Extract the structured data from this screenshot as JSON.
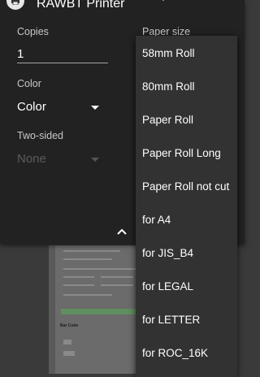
{
  "header": {
    "printer_name": "RAWBT Printer"
  },
  "copies": {
    "label": "Copies",
    "value": "1"
  },
  "color": {
    "label": "Color",
    "value": "Color"
  },
  "two_sided": {
    "label": "Two-sided",
    "value": "None"
  },
  "paper_size": {
    "label": "Paper size",
    "options": [
      "58mm Roll",
      "80mm Roll",
      "Paper Roll",
      "Paper Roll Long",
      "Paper Roll not cut",
      "for A4",
      "for JIS_B4",
      "for LEGAL",
      "for LETTER",
      "for ROC_16K"
    ]
  },
  "preview": {
    "section_title": "Bar Code"
  },
  "colors": {
    "panel": "#222222",
    "menu": "#323232",
    "text": "#ffffff",
    "label": "#c8c8c8"
  },
  "icons": {
    "printer": "printer-icon",
    "expand": "chevron-up-icon"
  }
}
